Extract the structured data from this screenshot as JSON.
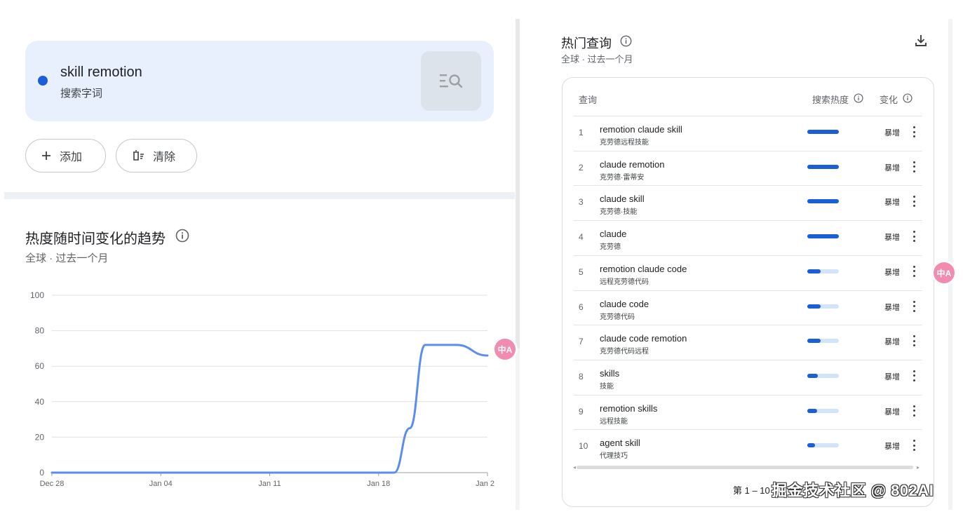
{
  "search": {
    "term": "skill remotion",
    "term_type": "搜索字词",
    "add_label": "添加",
    "clear_label": "清除",
    "term_color": "#1a5fd6"
  },
  "trend": {
    "title": "热度随时间变化的趋势",
    "subtitle": "全球 · 过去一个月"
  },
  "chart_data": {
    "type": "line",
    "x_tick_labels": [
      "Dec 28",
      "Jan 04",
      "Jan 11",
      "Jan 18",
      "Jan 2"
    ],
    "y_ticks": [
      0,
      20,
      40,
      60,
      80,
      100
    ],
    "ylim": [
      0,
      100
    ],
    "grid": true,
    "series": [
      {
        "color": "#5b8def",
        "points": [
          {
            "day": 0,
            "value": 0
          },
          {
            "day": 22,
            "value": 0
          },
          {
            "day": 23,
            "value": 25
          },
          {
            "day": 24,
            "value": 72
          },
          {
            "day": 26,
            "value": 72
          },
          {
            "day": 28,
            "value": 66
          }
        ]
      }
    ]
  },
  "related": {
    "title": "热门查询",
    "subtitle": "全球 · 过去一个月",
    "col_query": "查询",
    "col_heat": "搜索热度",
    "col_change": "变化",
    "rows": [
      {
        "rank": "1",
        "en": "remotion claude skill",
        "zh": "克劳德远程技能",
        "heat": 1.0,
        "change": "暴增"
      },
      {
        "rank": "2",
        "en": "claude remotion",
        "zh": "克劳德·雷蒂安",
        "heat": 1.0,
        "change": "暴增"
      },
      {
        "rank": "3",
        "en": "claude skill",
        "zh": "克劳德·技能",
        "heat": 1.0,
        "change": "暴增"
      },
      {
        "rank": "4",
        "en": "claude",
        "zh": "克劳德",
        "heat": 1.0,
        "change": "暴增"
      },
      {
        "rank": "5",
        "en": "remotion claude code",
        "zh": "远程克劳德代码",
        "heat": 0.42,
        "change": "暴增"
      },
      {
        "rank": "6",
        "en": "claude code",
        "zh": "克劳德代码",
        "heat": 0.42,
        "change": "暴增"
      },
      {
        "rank": "7",
        "en": "claude code remotion",
        "zh": "克劳德代码远程",
        "heat": 0.42,
        "change": "暴增"
      },
      {
        "rank": "8",
        "en": "skills",
        "zh": "技能",
        "heat": 0.33,
        "change": "暴增"
      },
      {
        "rank": "9",
        "en": "remotion skills",
        "zh": "远程技能",
        "heat": 0.3,
        "change": "暴增"
      },
      {
        "rank": "10",
        "en": "agent skill",
        "zh": "代理技巧",
        "heat": 0.25,
        "change": "暴增"
      }
    ],
    "pagination": "第 1 – 10"
  },
  "watermark": "掘金技术社区 @ 802AI",
  "translate_icon": "中A"
}
